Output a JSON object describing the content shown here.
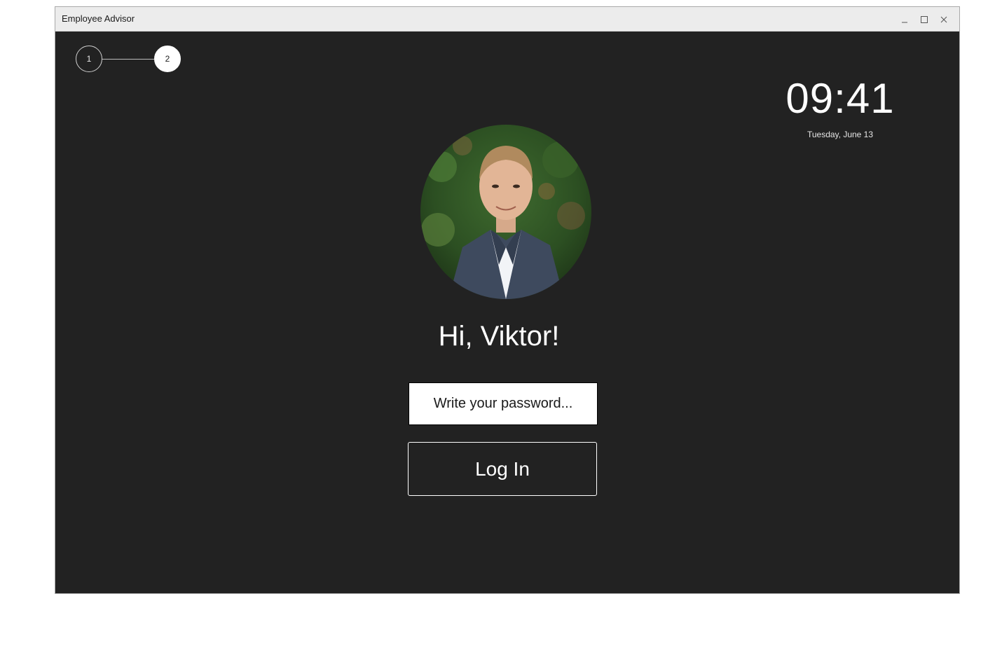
{
  "window": {
    "title": "Employee Advisor",
    "controls": [
      "minimize-icon",
      "maximize-icon",
      "close-icon"
    ]
  },
  "stepper": {
    "steps": [
      {
        "label": "1",
        "active": false
      },
      {
        "label": "2",
        "active": true
      }
    ]
  },
  "clock": {
    "time": "09:41",
    "date": "Tuesday, June 13"
  },
  "profile": {
    "avatar_icon": "user-photo",
    "greeting": "Hi, Viktor!"
  },
  "login": {
    "password_placeholder": "Write your password...",
    "button_label": "Log In"
  },
  "colors": {
    "background": "#222222",
    "titlebar": "#ececec",
    "text": "#ffffff"
  }
}
